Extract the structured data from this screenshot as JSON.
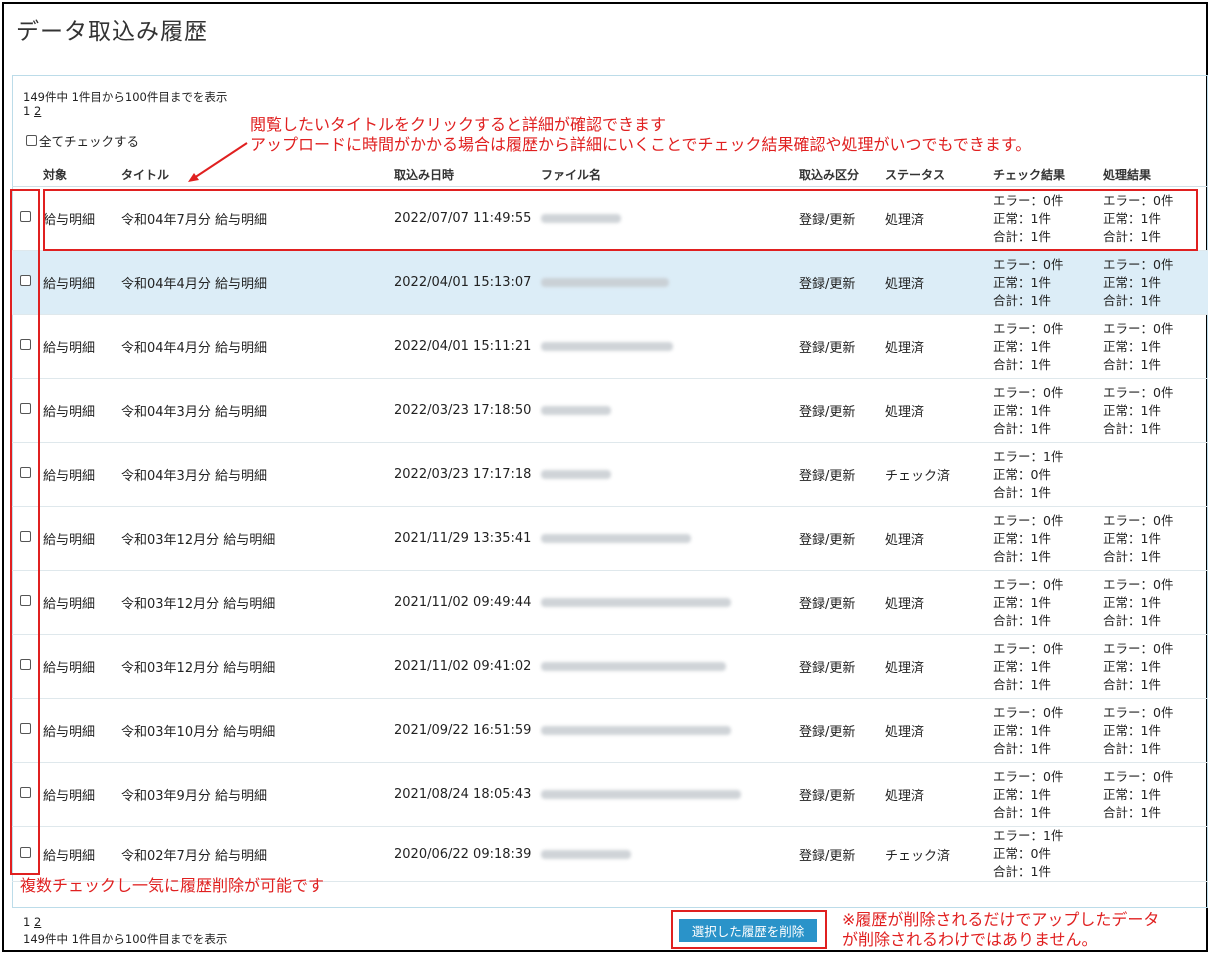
{
  "page": {
    "title": "データ取込み履歴"
  },
  "summary": {
    "top": "149件中 1件目から100件目までを表示",
    "bottom": "149件中 1件目から100件目までを表示"
  },
  "pager": {
    "current": "1",
    "next": "2"
  },
  "check_all_label": "全てチェックする",
  "columns": [
    "対象",
    "タイトル",
    "取込み日時",
    "ファイル名",
    "取込み区分",
    "ステータス",
    "チェック結果",
    "処理結果"
  ],
  "rows": [
    {
      "target": "給与明細",
      "title": "令和04年7月分 給与明細",
      "datetime": "2022/07/07 11:49:55",
      "kubun": "登録/更新",
      "status": "処理済",
      "check": [
        "エラー：0件",
        "正常：1件",
        "合計：1件"
      ],
      "proc": [
        "エラー：0件",
        "正常：1件",
        "合計：1件"
      ],
      "highlight": false
    },
    {
      "target": "給与明細",
      "title": "令和04年4月分 給与明細",
      "datetime": "2022/04/01 15:13:07",
      "kubun": "登録/更新",
      "status": "処理済",
      "check": [
        "エラー：0件",
        "正常：1件",
        "合計：1件"
      ],
      "proc": [
        "エラー：0件",
        "正常：1件",
        "合計：1件"
      ],
      "highlight": true
    },
    {
      "target": "給与明細",
      "title": "令和04年4月分 給与明細",
      "datetime": "2022/04/01 15:11:21",
      "kubun": "登録/更新",
      "status": "処理済",
      "check": [
        "エラー：0件",
        "正常：1件",
        "合計：1件"
      ],
      "proc": [
        "エラー：0件",
        "正常：1件",
        "合計：1件"
      ],
      "highlight": false
    },
    {
      "target": "給与明細",
      "title": "令和04年3月分 給与明細",
      "datetime": "2022/03/23 17:18:50",
      "kubun": "登録/更新",
      "status": "処理済",
      "check": [
        "エラー：0件",
        "正常：1件",
        "合計：1件"
      ],
      "proc": [
        "エラー：0件",
        "正常：1件",
        "合計：1件"
      ],
      "highlight": false
    },
    {
      "target": "給与明細",
      "title": "令和04年3月分 給与明細",
      "datetime": "2022/03/23 17:17:18",
      "kubun": "登録/更新",
      "status": "チェック済",
      "check": [
        "エラー：1件",
        "正常：0件",
        "合計：1件"
      ],
      "proc": [],
      "highlight": false
    },
    {
      "target": "給与明細",
      "title": "令和03年12月分 給与明細",
      "datetime": "2021/11/29 13:35:41",
      "kubun": "登録/更新",
      "status": "処理済",
      "check": [
        "エラー：0件",
        "正常：1件",
        "合計：1件"
      ],
      "proc": [
        "エラー：0件",
        "正常：1件",
        "合計：1件"
      ],
      "highlight": false
    },
    {
      "target": "給与明細",
      "title": "令和03年12月分 給与明細",
      "datetime": "2021/11/02 09:49:44",
      "kubun": "登録/更新",
      "status": "処理済",
      "check": [
        "エラー：0件",
        "正常：1件",
        "合計：1件"
      ],
      "proc": [
        "エラー：0件",
        "正常：1件",
        "合計：1件"
      ],
      "highlight": false
    },
    {
      "target": "給与明細",
      "title": "令和03年12月分 給与明細",
      "datetime": "2021/11/02 09:41:02",
      "kubun": "登録/更新",
      "status": "処理済",
      "check": [
        "エラー：0件",
        "正常：1件",
        "合計：1件"
      ],
      "proc": [
        "エラー：0件",
        "正常：1件",
        "合計：1件"
      ],
      "highlight": false
    },
    {
      "target": "給与明細",
      "title": "令和03年10月分 給与明細",
      "datetime": "2021/09/22 16:51:59",
      "kubun": "登録/更新",
      "status": "処理済",
      "check": [
        "エラー：0件",
        "正常：1件",
        "合計：1件"
      ],
      "proc": [
        "エラー：0件",
        "正常：1件",
        "合計：1件"
      ],
      "highlight": false
    },
    {
      "target": "給与明細",
      "title": "令和03年9月分 給与明細",
      "datetime": "2021/08/24 18:05:43",
      "kubun": "登録/更新",
      "status": "処理済",
      "check": [
        "エラー：0件",
        "正常：1件",
        "合計：1件"
      ],
      "proc": [
        "エラー：0件",
        "正常：1件",
        "合計：1件"
      ],
      "highlight": false
    },
    {
      "target": "給与明細",
      "title": "令和02年7月分 給与明細",
      "datetime": "2020/06/22 09:18:39",
      "kubun": "登録/更新",
      "status": "チェック済",
      "check": [
        "エラー：1件",
        "正常：0件",
        "合計：1件"
      ],
      "proc": [],
      "highlight": false
    }
  ],
  "delete_button": "選択した履歴を削除",
  "annotations": {
    "title_note_1": "閲覧したいタイトルをクリックすると詳細が確認できます",
    "title_note_2": "アップロードに時間がかかる場合は履歴から詳細にいくことでチェック結果確認や処理がいつでもできます。",
    "checkbox_note": "複数チェックし一気に履歴削除が可能です",
    "delete_note_1": "※履歴が削除されるだけでアップしたデータ",
    "delete_note_2": "が削除されるわけではありません。",
    "color": "#e02020"
  }
}
